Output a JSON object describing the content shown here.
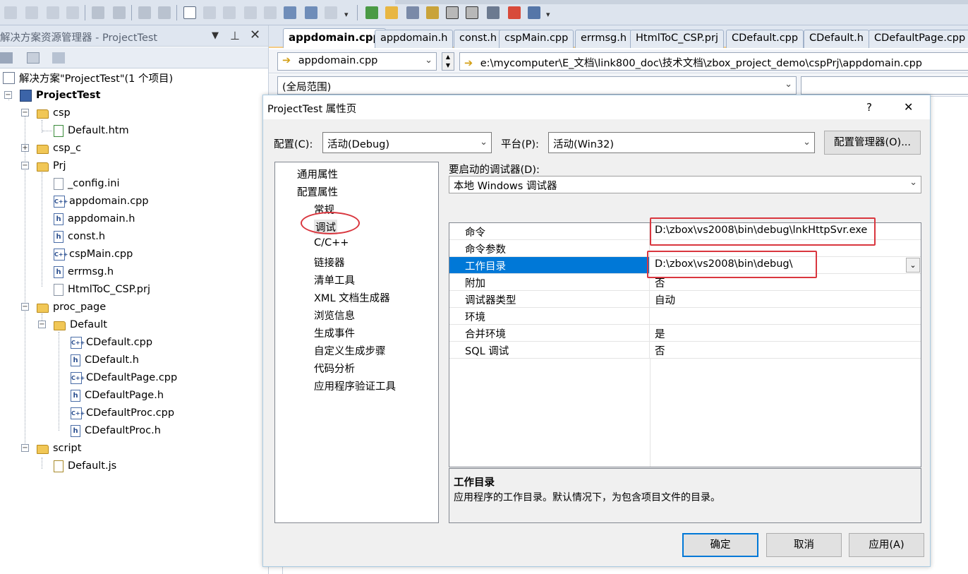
{
  "solution_explorer": {
    "title": "解决方案资源管理器 - ProjectTest",
    "pin": "▼ 中",
    "close": "✕",
    "tree": [
      {
        "label": "解决方案\"ProjectTest\"(1 个项目)"
      },
      {
        "label": "ProjectTest"
      },
      {
        "label": "csp"
      },
      {
        "label": "Default.htm"
      },
      {
        "label": "csp_c"
      },
      {
        "label": "Prj"
      },
      {
        "label": "_config.ini"
      },
      {
        "label": "appdomain.cpp"
      },
      {
        "label": "appdomain.h"
      },
      {
        "label": "const.h"
      },
      {
        "label": "cspMain.cpp"
      },
      {
        "label": "errmsg.h"
      },
      {
        "label": "HtmlToC_CSP.prj"
      },
      {
        "label": "proc_page"
      },
      {
        "label": "Default"
      },
      {
        "label": "CDefault.cpp"
      },
      {
        "label": "CDefault.h"
      },
      {
        "label": "CDefaultPage.cpp"
      },
      {
        "label": "CDefaultPage.h"
      },
      {
        "label": "CDefaultProc.cpp"
      },
      {
        "label": "CDefaultProc.h"
      },
      {
        "label": "script"
      },
      {
        "label": "Default.js"
      }
    ]
  },
  "editor": {
    "tabs": [
      "appdomain.cpp",
      "appdomain.h",
      "const.h",
      "cspMain.cpp",
      "errmsg.h",
      "HtmlToC_CSP.prj",
      "CDefault.cpp",
      "CDefault.h",
      "CDefaultPage.cpp"
    ],
    "file_combo": "appdomain.cpp",
    "path": "e:\\mycomputer\\E_文档\\link800_doc\\技术文档\\zbox_project_demo\\cspPrj\\appdomain.cpp",
    "scope": "(全局范围)"
  },
  "dialog": {
    "title": "ProjectTest 属性页",
    "help": "?",
    "close": "✕",
    "config_label": "配置(C):",
    "config_value": "活动(Debug)",
    "platform_label": "平台(P):",
    "platform_value": "活动(Win32)",
    "config_manager": "配置管理器(O)...",
    "nav": [
      {
        "label": "通用属性"
      },
      {
        "label": "配置属性"
      },
      {
        "label": "常规"
      },
      {
        "label": "调试"
      },
      {
        "label": "C/C++"
      },
      {
        "label": "链接器"
      },
      {
        "label": "清单工具"
      },
      {
        "label": "XML 文档生成器"
      },
      {
        "label": "浏览信息"
      },
      {
        "label": "生成事件"
      },
      {
        "label": "自定义生成步骤"
      },
      {
        "label": "代码分析"
      },
      {
        "label": "应用程序验证工具"
      }
    ],
    "debugger_label": "要启动的调试器(D):",
    "debugger_value": "本地 Windows 调试器",
    "properties": [
      {
        "key": "命令",
        "value": "D:\\zbox\\vs2008\\bin\\debug\\lnkHttpSvr.exe"
      },
      {
        "key": "命令参数",
        "value": ""
      },
      {
        "key": "工作目录",
        "value": "D:\\zbox\\vs2008\\bin\\debug\\"
      },
      {
        "key": "附加",
        "value": "否"
      },
      {
        "key": "调试器类型",
        "value": "自动"
      },
      {
        "key": "环境",
        "value": ""
      },
      {
        "key": "合并环境",
        "value": "是"
      },
      {
        "key": "SQL 调试",
        "value": "否"
      }
    ],
    "desc_title": "工作目录",
    "desc_text": "应用程序的工作目录。默认情况下，为包含项目文件的目录。",
    "ok": "确定",
    "cancel": "取消",
    "apply": "应用(A)"
  },
  "colors": {
    "selection": "#0078d7",
    "highlight_box": "#d9363e"
  }
}
